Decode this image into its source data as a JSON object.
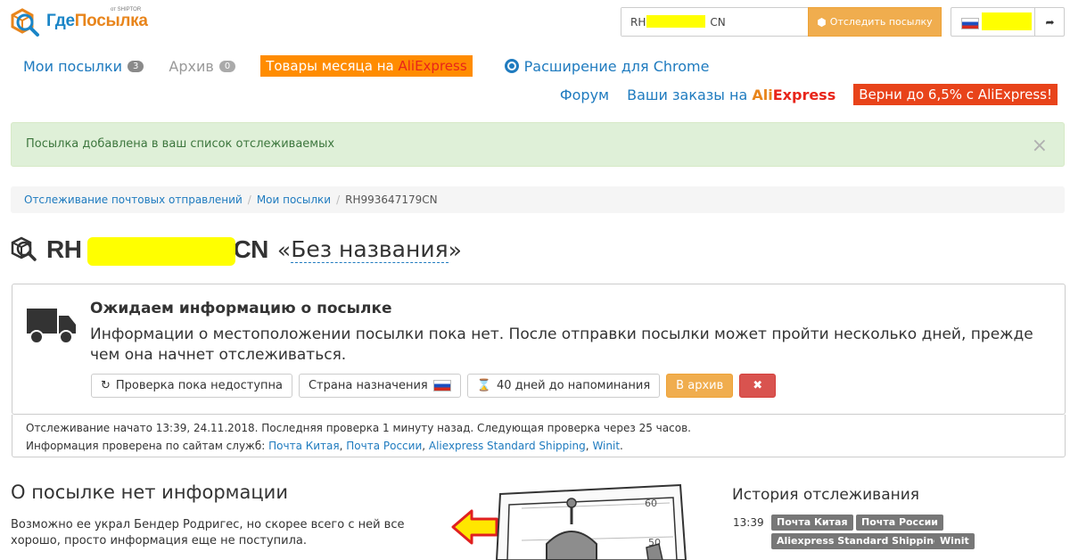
{
  "header": {
    "logo_text_a": "Где",
    "logo_text_b": "Посылка",
    "logo_sub": "от SHIPTOR",
    "search_value": "RH",
    "search_value_tail": "CN",
    "search_button": "Отследить посылку"
  },
  "nav": {
    "my_parcels": "Мои посылки",
    "my_parcels_count": "3",
    "archive": "Архив",
    "archive_count": "0",
    "promo_month": "Товары месяца на ",
    "promo_ali": "AliExpress",
    "chrome_ext": "Расширение для Chrome",
    "forum": "Форум",
    "orders_prefix": "Ваши заказы на ",
    "orders_ali_a": "Ali",
    "orders_ali_b": "Express",
    "cashback": "Верни до 6,5% с AliExpress!"
  },
  "alert": {
    "message": "Посылка добавлена в ваш список отслеживаемых",
    "close": "×"
  },
  "breadcrumb": {
    "items": [
      "Отслеживание почтовых отправлений",
      "Мои посылки",
      "RH993647179CN"
    ],
    "sep": "/"
  },
  "parcel": {
    "track_head": "RH",
    "track_tail": "CN",
    "quote_open": "«",
    "name": "Без названия",
    "quote_close": "»"
  },
  "status": {
    "title": "Ожидаем информацию о посылке",
    "description": "Информации о местоположении посылки пока нет. После отправки посылки может пройти несколько дней, прежде чем она начнет отслеживаться.",
    "chip_check": "Проверка пока недоступна",
    "chip_country": "Страна назначения",
    "chip_reminder": "40 дней до напоминания",
    "archive_button": "В архив",
    "delete_button": "✖"
  },
  "tracking_info": {
    "line1": "Отслеживание начато 13:39, 24.11.2018. Последняя проверка 1 минуту назад. Следующая проверка через 25 часов.",
    "line2_prefix": "Информация проверена по сайтам служб: ",
    "services": [
      "Почта Китая",
      "Почта России",
      "Aliexpress Standard Shipping",
      "Winit"
    ],
    "services_sep": ", ",
    "end": "."
  },
  "no_info": {
    "heading": "О посылке нет информации",
    "text": "Возможно ее украл Бендер Родригес, но скорее всего с ней все хорошо, просто информация еще не поступила."
  },
  "history": {
    "heading": "История отслеживания",
    "time": "13:39",
    "tags": [
      "Почта Китая",
      "Почта России",
      "Aliexpress Standard Shipping",
      "Winit"
    ]
  },
  "illustration": {
    "mark_top": "60",
    "mark_bottom": "50"
  },
  "colors": {
    "link": "#1f7bbf",
    "orange": "#f0ad4e",
    "red": "#d9534f",
    "alert_bg": "#dff0d8",
    "redaction": "#ffff00"
  }
}
